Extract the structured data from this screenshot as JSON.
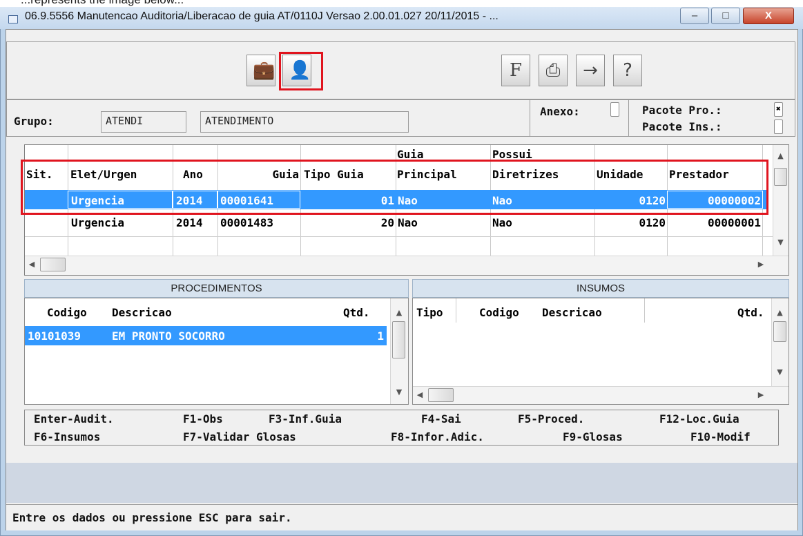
{
  "top_caption": "...represents the image below...",
  "window": {
    "title": "06.9.5556 Manutencao  Auditoria/Liberacao de guia AT/0110J Versao 2.00.01.027 20/11/2015 - ...",
    "controls": {
      "minimize": "–",
      "maximize": "□",
      "close": "X"
    }
  },
  "toolbar": {
    "left_buttons": [
      {
        "name": "briefcase-icon",
        "glyph": "💼"
      },
      {
        "name": "person-card-icon",
        "glyph": "👤"
      }
    ],
    "right_buttons": [
      {
        "name": "f-key-icon",
        "glyph": "F"
      },
      {
        "name": "printer-icon",
        "glyph": "⎙"
      },
      {
        "name": "exit-door-icon",
        "glyph": "→"
      },
      {
        "name": "help-icon",
        "glyph": "?"
      }
    ]
  },
  "group": {
    "label": "Grupo:",
    "code": "ATENDI",
    "description": "ATENDIMENTO",
    "anexo_label": "Anexo:",
    "pacote_pro_label": "Pacote Pro.:",
    "pacote_ins_label": "Pacote Ins.:"
  },
  "guias": {
    "header_top": [
      "",
      "",
      "",
      "",
      "",
      "Guia",
      "Possui",
      "",
      ""
    ],
    "header": [
      "Sit.",
      "Elet/Urgen",
      "Ano",
      "Guia",
      "Tipo Guia",
      "Principal",
      "Diretrizes",
      "Unidade",
      "Prestador"
    ],
    "rows": [
      [
        "",
        "Urgencia",
        "2014",
        "00001641",
        "01",
        "Nao",
        "Nao",
        "0120",
        "00000002"
      ],
      [
        "",
        "Urgencia",
        "2014",
        "00001483",
        "20",
        "Nao",
        "Nao",
        "0120",
        "00000001"
      ]
    ],
    "selected_row": 0
  },
  "procedimentos": {
    "title": "PROCEDIMENTOS",
    "headers": [
      "Codigo",
      "Descricao",
      "Qtd."
    ],
    "rows": [
      [
        "10101039",
        "EM PRONTO SOCORRO",
        "1"
      ]
    ]
  },
  "insumos": {
    "title": "INSUMOS",
    "headers": [
      "Tipo",
      "Codigo",
      "Descricao",
      "Qtd."
    ]
  },
  "function_keys": {
    "row1": [
      "Enter-Audit.",
      "F1-Obs",
      "F3-Inf.Guia",
      "F4-Sai",
      "F5-Proced.",
      "F12-Loc.Guia"
    ],
    "row2": [
      "F6-Insumos",
      "F7-Validar Glosas",
      "F8-Infor.Adic.",
      "F9-Glosas",
      "F10-Modif"
    ]
  },
  "status_text": "Entre os dados ou pressione ESC para sair.",
  "colors": {
    "selection": "#3399ff",
    "highlight": "#e0141e",
    "titlebar": "#c9dbef"
  }
}
